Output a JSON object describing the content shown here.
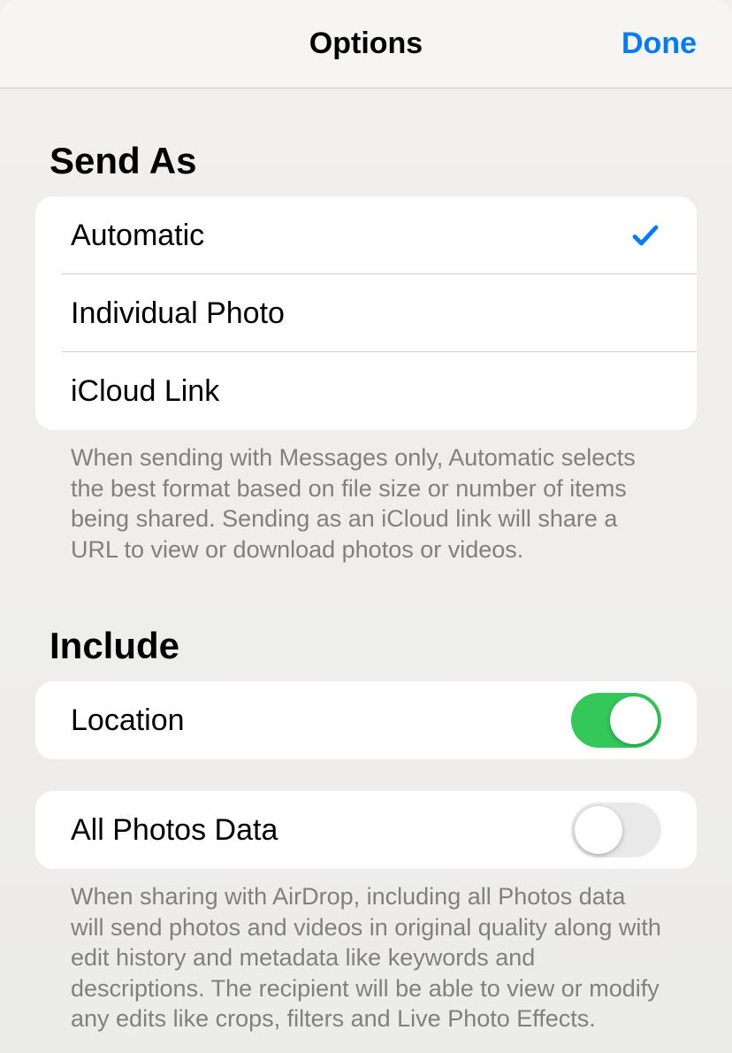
{
  "header": {
    "title": "Options",
    "done": "Done"
  },
  "sendAs": {
    "header": "Send As",
    "options": [
      {
        "label": "Automatic",
        "selected": true
      },
      {
        "label": "Individual Photo",
        "selected": false
      },
      {
        "label": "iCloud Link",
        "selected": false
      }
    ],
    "footer": "When sending with Messages only, Automatic selects the best format based on file size or number of items being shared. Sending as an iCloud link will share a URL to view or download photos or videos."
  },
  "include": {
    "header": "Include",
    "location": {
      "label": "Location",
      "on": true
    },
    "allPhotosData": {
      "label": "All Photos Data",
      "on": false
    },
    "footer": "When sharing with AirDrop, including all Photos data will send photos and videos in original quality along with edit history and metadata like keywords and descriptions. The recipient will be able to view or modify any edits like crops, filters and Live Photo Effects."
  },
  "colors": {
    "accent": "#007aff",
    "toggleOn": "#34c759"
  }
}
